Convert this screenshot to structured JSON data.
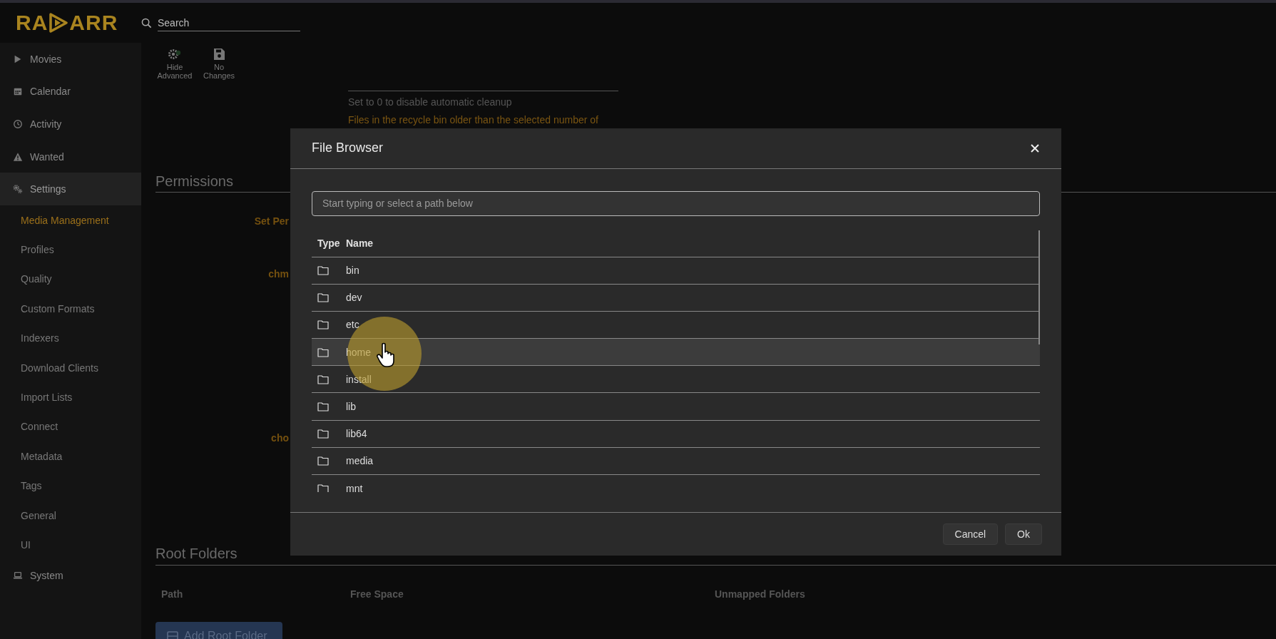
{
  "logo": {
    "left": "RA",
    "right": "ARR"
  },
  "search": {
    "placeholder": "Search"
  },
  "sidebar": {
    "items": [
      {
        "label": "Movies",
        "selected": false
      },
      {
        "label": "Calendar",
        "selected": false
      },
      {
        "label": "Activity",
        "selected": false
      },
      {
        "label": "Wanted",
        "selected": false
      },
      {
        "label": "Settings",
        "selected": true,
        "children": [
          {
            "label": "Media Management",
            "selected": true
          },
          {
            "label": "Profiles",
            "selected": false
          },
          {
            "label": "Quality",
            "selected": false
          },
          {
            "label": "Custom Formats",
            "selected": false
          },
          {
            "label": "Indexers",
            "selected": false
          },
          {
            "label": "Download Clients",
            "selected": false
          },
          {
            "label": "Import Lists",
            "selected": false
          },
          {
            "label": "Connect",
            "selected": false
          },
          {
            "label": "Metadata",
            "selected": false
          },
          {
            "label": "Tags",
            "selected": false
          },
          {
            "label": "General",
            "selected": false
          },
          {
            "label": "UI",
            "selected": false
          }
        ]
      },
      {
        "label": "System",
        "selected": false
      }
    ]
  },
  "toolbar": [
    {
      "label": "Hide Advanced",
      "kind": "advanced"
    },
    {
      "label": "No Changes",
      "kind": "save"
    }
  ],
  "page": {
    "field_help": "Set to 0 to disable automatic cleanup",
    "field_warning": "Files in the recycle bin older than the selected number of",
    "permissions": {
      "title": "Permissions",
      "labels": [
        "Set Per",
        "chm",
        "cho"
      ]
    },
    "root_folders": {
      "title": "Root Folders",
      "columns": [
        "Path",
        "Free Space",
        "Unmapped Folders"
      ],
      "add_button": "Add Root Folder"
    }
  },
  "dialog": {
    "title": "File Browser",
    "path_field": {
      "placeholder": "Start typing or select a path below"
    },
    "columns": [
      "Type",
      "Name"
    ],
    "rows": [
      {
        "name": "bin",
        "selected": false
      },
      {
        "name": "dev",
        "selected": false
      },
      {
        "name": "etc",
        "selected": false
      },
      {
        "name": "home",
        "selected": true
      },
      {
        "name": "install",
        "selected": false
      },
      {
        "name": "lib",
        "selected": false
      },
      {
        "name": "lib64",
        "selected": false
      },
      {
        "name": "media",
        "selected": false
      },
      {
        "name": "mnt",
        "selected": false
      }
    ],
    "buttons": [
      "Cancel",
      "Ok"
    ]
  }
}
